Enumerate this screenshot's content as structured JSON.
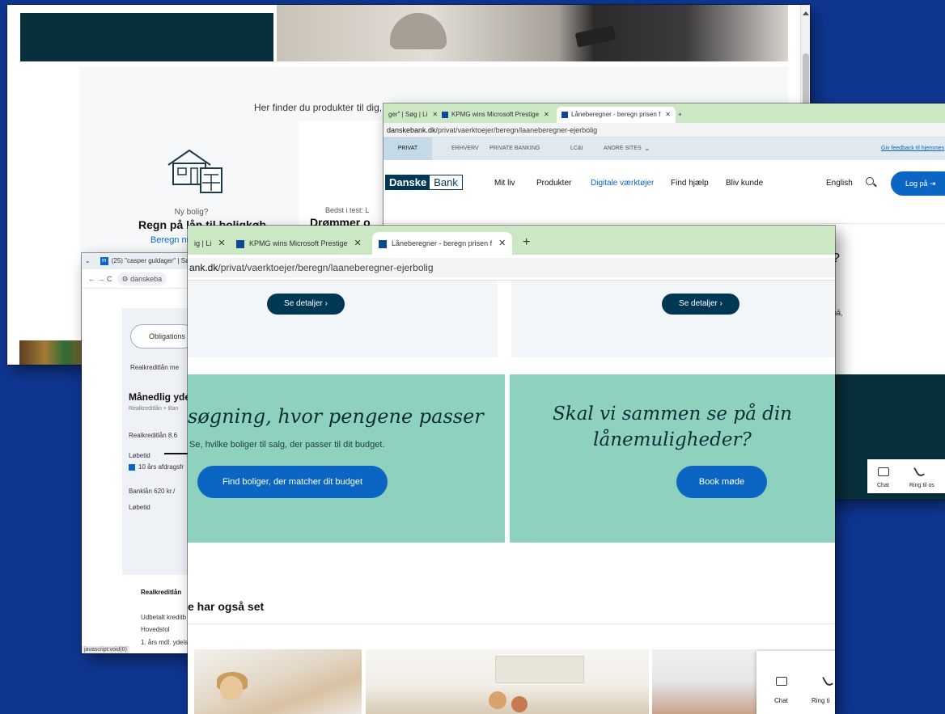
{
  "winA": {
    "intro": "Her finder du produkter til dig, famil",
    "card1": {
      "eyebrow": "Ny bolig?",
      "heading": "Regn på lån til boligkøb",
      "link": "Beregn nu"
    },
    "card2": {
      "eyebrow": "Bedst i test: L",
      "heading": "Drømmer o"
    }
  },
  "winB": {
    "tabs": [
      {
        "label": "ger\" | Søg | Li"
      },
      {
        "label": "KPMG wins Microsoft Prestige"
      },
      {
        "label": "Låneberegner - beregn prisen f"
      }
    ],
    "url_host": "danskebank.dk",
    "url_path": "/privat/vaerktoejer/beregn/laaneberegner-ejerbolig",
    "topnav": [
      "PRIVAT",
      "ERHVERV",
      "PRIVATE BANKING",
      "LC&I",
      "ANDRE SITES"
    ],
    "feedback": "Giv feedback til hjemmes",
    "logo": [
      "Danske",
      "Bank"
    ],
    "nav": [
      "Mit liv",
      "Produkter",
      "Digitale værktøjer",
      "Find hjælp",
      "Bliv kunde"
    ],
    "lang": "English",
    "login": "Log på",
    "qmark": "?",
    "partial": "på,",
    "fab": {
      "chat": "Chat",
      "call": "Ring til os"
    }
  },
  "winC": {
    "tab": "(25) \"casper guldager\" | Søg",
    "url": "danskeba",
    "seg": "Obligations",
    "line1": "Realkreditlån me",
    "heading": "Månedlig yde",
    "sub": "Realkreditlån + Ban",
    "loan1": "Realkreditlån 8.6",
    "term1": "Løbetid",
    "check": "10 års afdragsfr",
    "loan2": "Banklån 620 kr./",
    "term2": "Løbetid",
    "sec": "Realkreditlån",
    "r1": "Udbetalt kreditb",
    "r2": "Hovedstol",
    "r3": "1. års mdl. ydels",
    "status": "javascript:void(0)"
  },
  "winD": {
    "tabs": [
      {
        "label": "ig | Li"
      },
      {
        "label": "KPMG wins Microsoft Prestige"
      },
      {
        "label": "Låneberegner - beregn prisen f"
      }
    ],
    "url_host": "ank.dk",
    "url_path": "/privat/vaerktoejer/beregn/laaneberegner-ejerbolig",
    "detail_btn_left": "Se detaljer",
    "detail_btn_right": "Se detaljer",
    "promo_left": {
      "heading": "søgning, hvor pengene passer",
      "sub": "Se, hvilke boliger til salg, der passer til dit budget.",
      "cta": "Find boliger, der matcher dit budget"
    },
    "promo_right": {
      "line1": "Skal vi sammen se på din",
      "line2": "lånemuligheder?",
      "cta": "Book møde"
    },
    "also": "e har også set",
    "fab": {
      "chat": "Chat",
      "call": "Ring ti"
    }
  }
}
